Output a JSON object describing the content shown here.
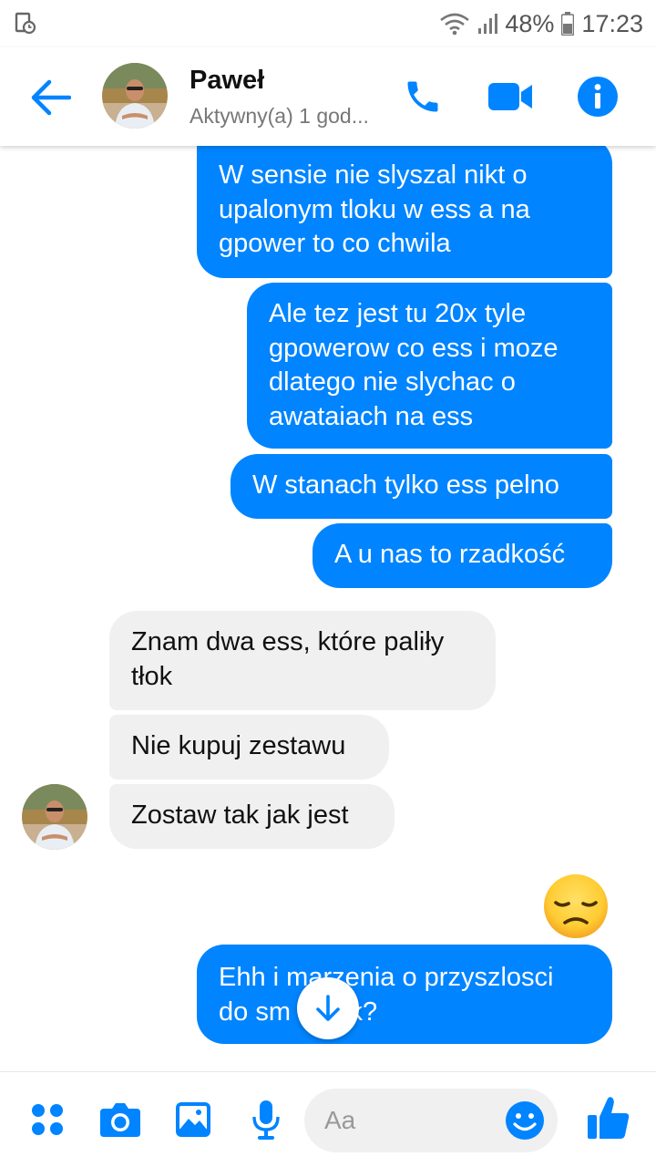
{
  "status_bar": {
    "battery": "48%",
    "time": "17:23"
  },
  "header": {
    "contact_name": "Paweł",
    "contact_status": "Aktywny(a) 1 god..."
  },
  "messages": [
    {
      "side": "out",
      "lines": [
        "W sensie nie slyszal nikt o",
        "upalonym tloku w ess a na",
        "gpower to co chwila"
      ]
    },
    {
      "side": "out",
      "lines": [
        "Ale tez jest tu 20x tyle",
        "gpowerow co ess i moze",
        "dlatego nie slychac o",
        "awataiach na ess"
      ]
    },
    {
      "side": "out",
      "lines": [
        "W stanach tylko ess pelno"
      ]
    },
    {
      "side": "out",
      "lines": [
        "A u nas to rzadkość"
      ]
    },
    {
      "side": "in",
      "lines": [
        "Znam dwa ess, które paliły",
        "tłok"
      ]
    },
    {
      "side": "in",
      "lines": [
        "Nie kupuj zestawu"
      ]
    },
    {
      "side": "in",
      "lines": [
        "Zostaw tak jak jest"
      ]
    },
    {
      "side": "out",
      "lines": [
        "Ehh i marzenia o przyszlosci",
        "do sm      ak?"
      ]
    }
  ],
  "reaction_emoji": "pensive-face",
  "composer": {
    "placeholder": "Aa"
  },
  "colors": {
    "accent": "#0084ff",
    "incoming_bubble": "#f1f0f0",
    "emoji_yellow": "#ffcc33"
  }
}
